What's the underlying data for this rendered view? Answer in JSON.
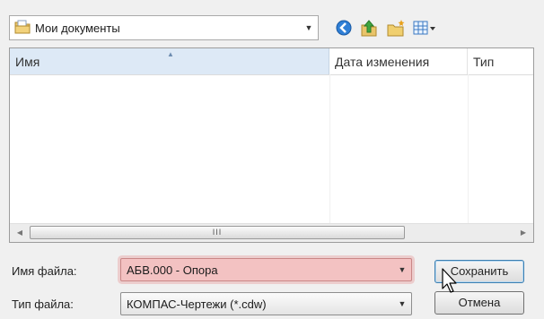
{
  "location": {
    "current_folder": "Мои документы",
    "folder_icon": "documents-folder-icon",
    "toolbar_icons": [
      "back-icon",
      "up-folder-icon",
      "new-folder-icon",
      "view-menu-icon"
    ]
  },
  "file_list": {
    "columns": [
      "Имя",
      "Дата изменения",
      "Тип"
    ],
    "sorted_column": "Имя",
    "rows": [],
    "scrollbar_grip": "III"
  },
  "form": {
    "filename_label": "Имя файла:",
    "filename_value": "АБВ.000 - Опора",
    "filetype_label": "Тип файла:",
    "filetype_value": "КОМПАС-Чертежи (*.cdw)",
    "save_button": "Сохранить",
    "cancel_button": "Отмена"
  },
  "colors": {
    "filename_highlight": "#f3c2c2",
    "header_sorted": "#dde9f6",
    "save_focus": "#3c7fb1"
  }
}
